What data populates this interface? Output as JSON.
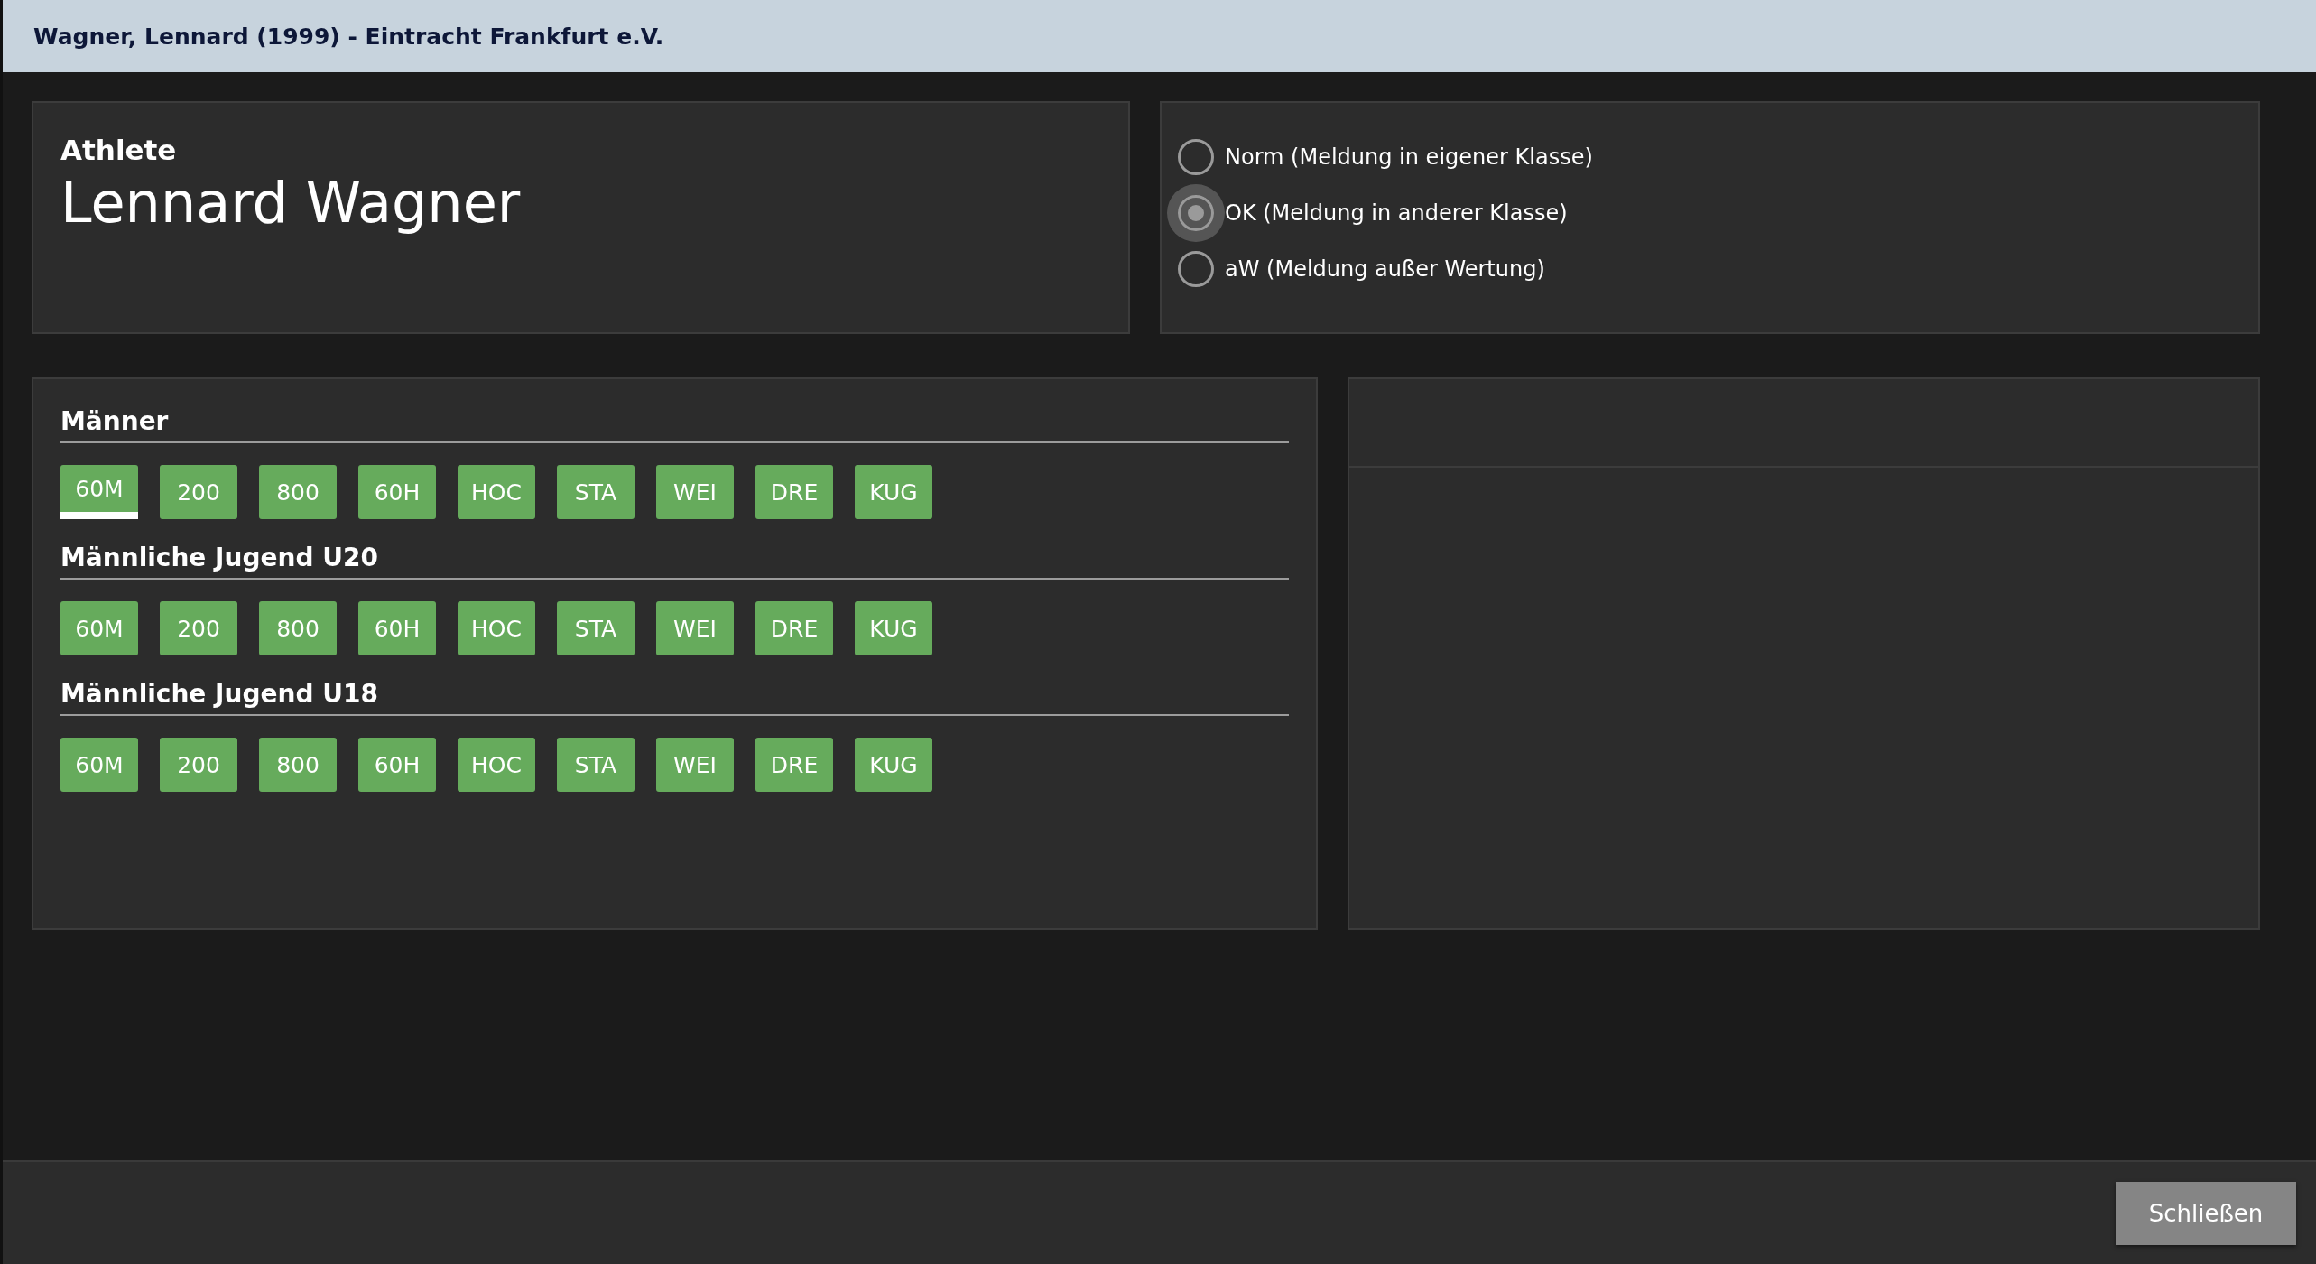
{
  "window": {
    "title": "Wagner, Lennard (1999) - Eintracht Frankfurt e.V."
  },
  "athlete": {
    "label": "Athlete",
    "name": "Lennard Wagner"
  },
  "entry_options": [
    {
      "label": "Norm (Meldung in eigener Klasse)",
      "selected": false
    },
    {
      "label": "OK (Meldung in anderer Klasse)",
      "selected": true
    },
    {
      "label": "aW (Meldung außer Wertung)",
      "selected": false
    }
  ],
  "event_groups": [
    {
      "title": "Männer",
      "events": [
        {
          "label": "60M",
          "selected": true
        },
        {
          "label": "200",
          "selected": false
        },
        {
          "label": "800",
          "selected": false
        },
        {
          "label": "60H",
          "selected": false
        },
        {
          "label": "HOC",
          "selected": false
        },
        {
          "label": "STA",
          "selected": false
        },
        {
          "label": "WEI",
          "selected": false
        },
        {
          "label": "DRE",
          "selected": false
        },
        {
          "label": "KUG",
          "selected": false
        }
      ]
    },
    {
      "title": "Männliche Jugend U20",
      "events": [
        {
          "label": "60M",
          "selected": false
        },
        {
          "label": "200",
          "selected": false
        },
        {
          "label": "800",
          "selected": false
        },
        {
          "label": "60H",
          "selected": false
        },
        {
          "label": "HOC",
          "selected": false
        },
        {
          "label": "STA",
          "selected": false
        },
        {
          "label": "WEI",
          "selected": false
        },
        {
          "label": "DRE",
          "selected": false
        },
        {
          "label": "KUG",
          "selected": false
        }
      ]
    },
    {
      "title": "Männliche Jugend U18",
      "events": [
        {
          "label": "60M",
          "selected": false
        },
        {
          "label": "200",
          "selected": false
        },
        {
          "label": "800",
          "selected": false
        },
        {
          "label": "60H",
          "selected": false
        },
        {
          "label": "HOC",
          "selected": false
        },
        {
          "label": "STA",
          "selected": false
        },
        {
          "label": "WEI",
          "selected": false
        },
        {
          "label": "DRE",
          "selected": false
        },
        {
          "label": "KUG",
          "selected": false
        }
      ]
    }
  ],
  "close_button": {
    "label": "Schließen"
  }
}
